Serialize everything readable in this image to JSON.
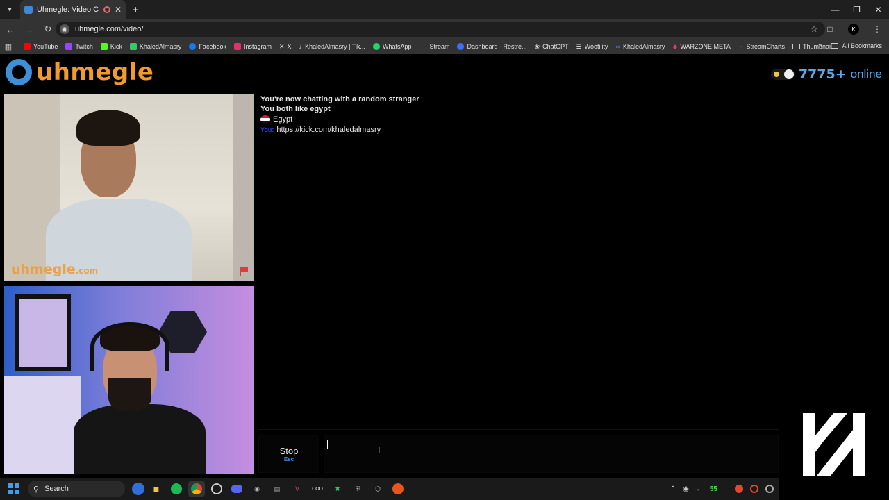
{
  "browser": {
    "tab_title": "Uhmegle: Video Chat | Ome",
    "url": "uhmegle.com/video/",
    "bookmarks": [
      {
        "label": "YouTube",
        "color": "#ff0000"
      },
      {
        "label": "Twitch",
        "color": "#9146ff"
      },
      {
        "label": "Kick",
        "color": "#53fc18"
      },
      {
        "label": "KhaledAlmasry",
        "color": "#2ecc71"
      },
      {
        "label": "Facebook",
        "color": "#1877f2"
      },
      {
        "label": "Instagram",
        "color": "#e1306c"
      },
      {
        "label": "X",
        "color": "#cccccc"
      },
      {
        "label": "KhaledAlmasry | Tik...",
        "color": "#dddddd"
      },
      {
        "label": "WhatsApp",
        "color": "#25d366"
      },
      {
        "label": "Stream",
        "color": "#bbbbbb"
      },
      {
        "label": "Dashboard - Restre...",
        "color": "#3b6ff5"
      },
      {
        "label": "ChatGPT",
        "color": "#cccccc"
      },
      {
        "label": "Wootility",
        "color": "#dddddd"
      },
      {
        "label": "KhaledAlmasry",
        "color": "#4a7cf5"
      },
      {
        "label": "WARZONE META",
        "color": "#e04060"
      },
      {
        "label": "StreamCharts",
        "color": "#7b5cf5"
      },
      {
        "label": "Thumbnail",
        "color": "#bbbbbb"
      }
    ],
    "all_bookmarks": "All Bookmarks"
  },
  "site": {
    "logo_text": "uhmegle",
    "online_count": "7775+",
    "online_label": "online",
    "watermark": "uhmegle",
    "watermark_suffix": ".com"
  },
  "chat": {
    "status": "You're now chatting with a random stranger",
    "common_interest": "You both like egypt",
    "country": "Egypt",
    "you_label": "You:",
    "you_message": "https://kick.com/khaledalmasry"
  },
  "controls": {
    "stop_label": "Stop",
    "stop_key": "Esc",
    "input_value": ""
  },
  "taskbar": {
    "search_label": "Search",
    "fps": "55"
  },
  "colors": {
    "brand_orange": "#f29a2e",
    "brand_blue": "#5aa7e8"
  }
}
